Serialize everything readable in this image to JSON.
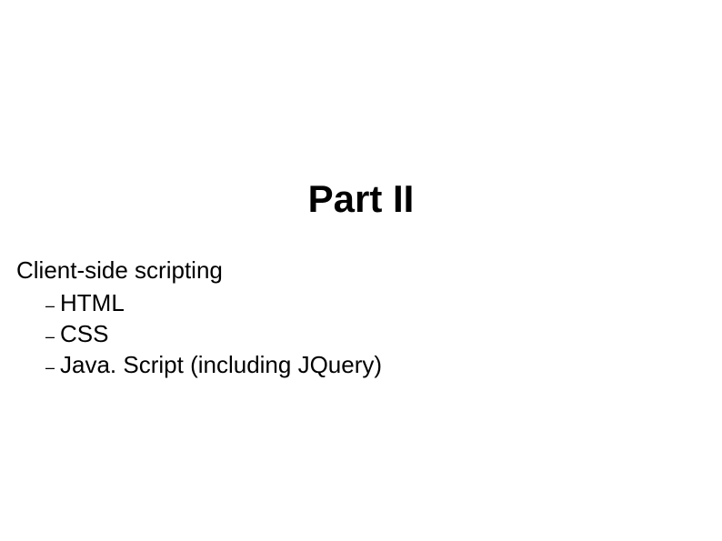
{
  "title": "Part II",
  "section_heading": "Client-side scripting",
  "items": [
    "HTML",
    "CSS",
    "Java. Script (including JQuery)"
  ],
  "dash": "–"
}
